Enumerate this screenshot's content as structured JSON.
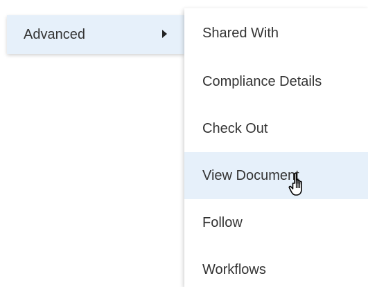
{
  "parent_menu": {
    "item_label": "Advanced",
    "item_arrow_icon": "triangle-right-icon"
  },
  "submenu": {
    "items": [
      {
        "label": "Shared With"
      },
      {
        "label": "Compliance Details"
      },
      {
        "label": "Check Out"
      },
      {
        "label": "View Document"
      },
      {
        "label": "Follow"
      },
      {
        "label": "Workflows"
      }
    ],
    "highlighted_label": "View Document"
  },
  "cursor": {
    "icon": "hand-pointer-icon"
  },
  "colors": {
    "highlight": "#e6f0fa",
    "text": "#333333",
    "background": "#ffffff"
  }
}
